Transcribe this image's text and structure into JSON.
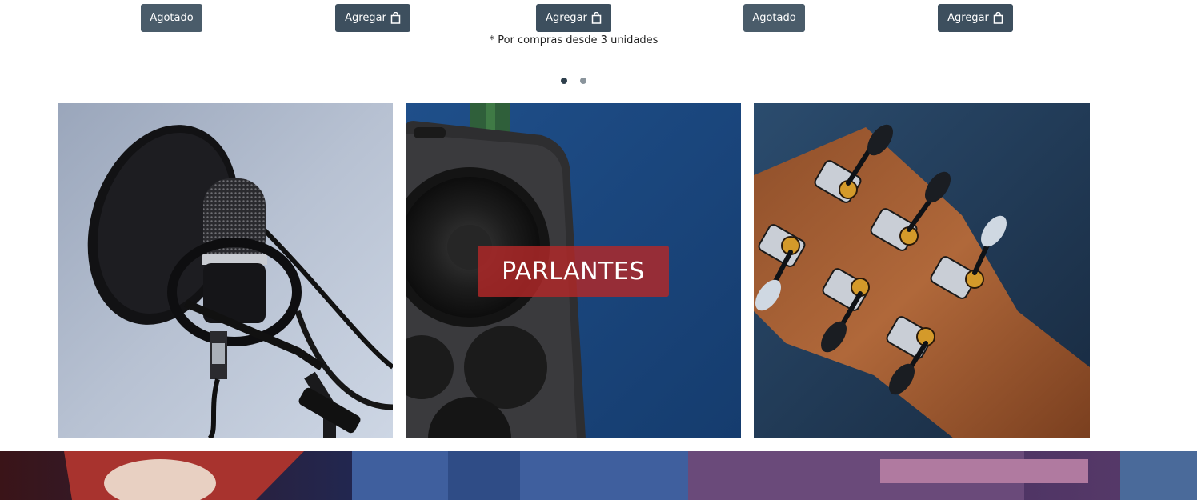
{
  "products": [
    {
      "button_label": "Agotado",
      "status": "sold-out"
    },
    {
      "button_label": "Agregar",
      "status": "available",
      "icon": "shopping-bag-icon"
    },
    {
      "button_label": "Agregar",
      "status": "available",
      "icon": "shopping-bag-icon"
    },
    {
      "button_label": "Agotado",
      "status": "sold-out"
    },
    {
      "button_label": "Agregar",
      "status": "available",
      "icon": "shopping-bag-icon"
    }
  ],
  "footnote": "* Por compras desde 3 unidades",
  "carousel": {
    "total_pages": 2,
    "active_page": 1
  },
  "categories": [
    {
      "image": "microphone-photo"
    },
    {
      "image": "speaker-photo",
      "label": "PARLANTES"
    },
    {
      "image": "guitar-headstock-photo"
    }
  ],
  "colors": {
    "button": "#3d4f5e",
    "label_overlay": "#b22828",
    "price": "#d42b2b",
    "dot_active": "#2e3f4c",
    "dot_inactive": "#8a949c"
  }
}
